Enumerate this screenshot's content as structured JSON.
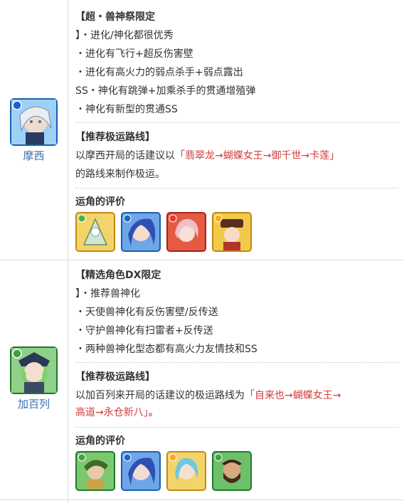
{
  "entries": [
    {
      "character_name": "摩西",
      "section_title": "【超・兽神祭限定",
      "points": [
        "】・进化/神化都很优秀",
        "・进化有飞行+超反伤害壁",
        "・进化有高火力的弱点杀手+弱点露出",
        "SS・神化有跳弹+加乘杀手的贯通增殖弹",
        "・神化有新型的贯通SS"
      ],
      "route_title": "【推荐极运路线】",
      "route_line1_prefix": "以摩西开局的话建议以",
      "route_line1_red": "「翡翠龙→蝴蝶女王→御千世→卡莲」",
      "route_line2": "的路线来制作极运。",
      "eval_title": "运角的评价",
      "icons": [
        "green-dragon-icon",
        "blue-haired-heroine-icon",
        "red-pink-haired-girl-icon",
        "yellow-hat-girl-icon"
      ]
    },
    {
      "character_name": "加百列",
      "section_title": "【精选角色DX限定",
      "points": [
        "】・推荐兽神化",
        "・天使兽神化有反伤害壁/反传送",
        "・守护兽神化有扫雷者+反传送",
        "・两种兽神化型态都有高火力友情技和SS"
      ],
      "route_title": "【推荐极运路线】",
      "route_line1_prefix": "以加百列来开局的话建议的极运路线为",
      "route_line1_red": "「自来也→蝴蝶女王→",
      "route_line2_red": "高道→永仓新八」",
      "route_line2_suffix": "。",
      "eval_title": "运角的评价",
      "icons": [
        "green-warrior-icon",
        "blue-haired-heroine-icon",
        "blue-haired-girl-icon",
        "green-bearded-man-icon"
      ]
    }
  ],
  "colors": {
    "accent_red": "#d23a3a",
    "name_blue": "#3a6fb0",
    "border": "#dcdcdc"
  }
}
